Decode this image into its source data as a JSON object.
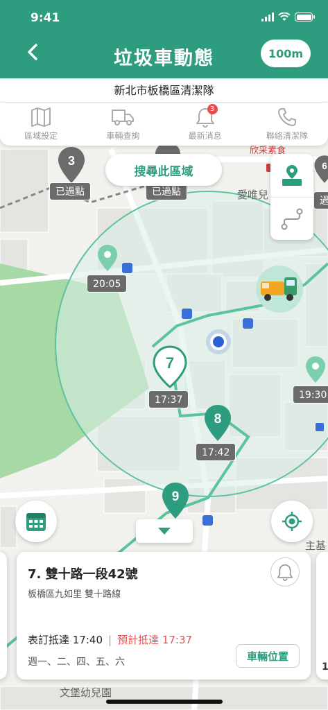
{
  "status_bar": {
    "time": "9:41"
  },
  "header": {
    "title": "垃圾車動態",
    "range_label": "100m"
  },
  "subheader": {
    "team": "新北市板橋區清潔隊"
  },
  "tabs": [
    {
      "label": "區域設定",
      "icon": "map-icon"
    },
    {
      "label": "車輛查詢",
      "icon": "truck-icon"
    },
    {
      "label": "最新消息",
      "icon": "bell-icon",
      "badge": "3"
    },
    {
      "label": "聯絡清潔隊",
      "icon": "phone-icon"
    }
  ],
  "map": {
    "search_area_label": "搜尋此區域",
    "place_labels": {
      "aiwei": "愛唯兒",
      "market": "欣采素食",
      "main_base": "主基",
      "kindergarten": "文堡幼兒園"
    },
    "stops": [
      {
        "number": "3",
        "label": "已過點"
      },
      {
        "number": "",
        "label": "已過點"
      },
      {
        "number": "6",
        "label": "過"
      },
      {
        "number": "",
        "label": "20:05"
      },
      {
        "number": "7",
        "label": "17:37"
      },
      {
        "number": "8",
        "label": "17:42"
      },
      {
        "number": "",
        "label": "19:30"
      },
      {
        "number": "9",
        "label": ""
      }
    ],
    "colors": {
      "primary": "#2e9c7e",
      "route": "#5cc3a0",
      "radius_fill": "#d9efe6",
      "park": "#a6d9a6",
      "user_dot": "#2a62d6"
    }
  },
  "card": {
    "address": "7. 雙十路一段42號",
    "area": "板橋區九如里 雙十路線",
    "scheduled_label": "表訂抵達 17:40",
    "separator": "|",
    "estimated_label": "預計抵達 17:37",
    "days": "週一、二、四、五、六",
    "vehicle_button": "車輛位置",
    "side_card_fragment": "1"
  }
}
